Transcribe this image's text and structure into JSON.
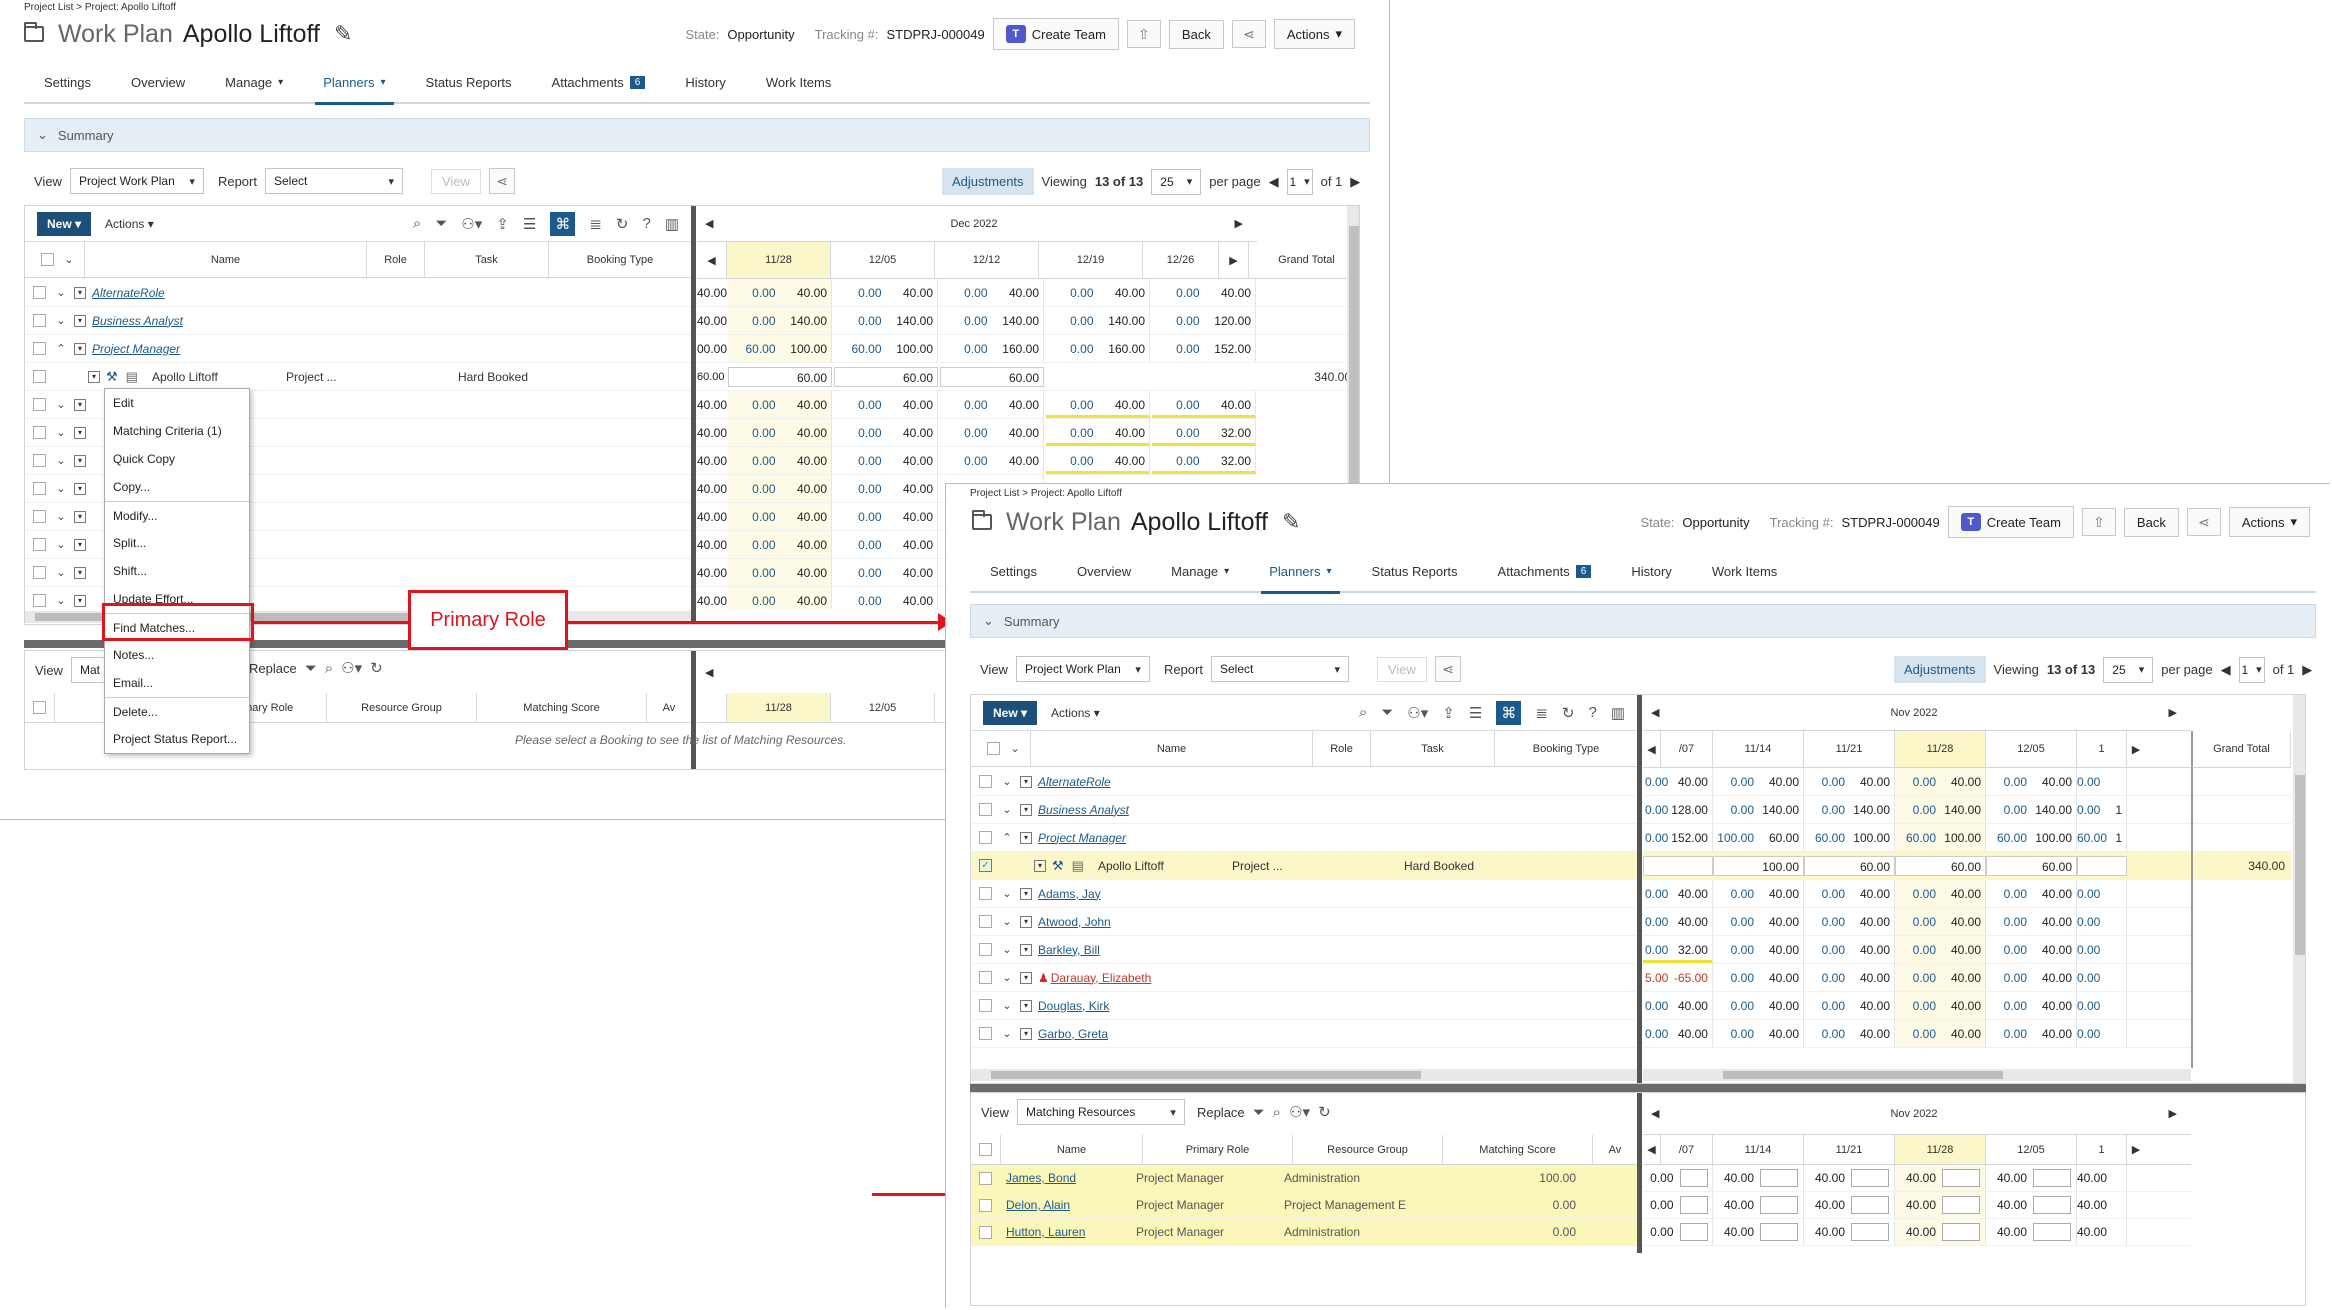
{
  "common": {
    "breadcrumb": "Project List > Project: Apollo Liftoff",
    "work_plan_label": "Work Plan",
    "project_name": "Apollo Liftoff",
    "state_label": "State:",
    "state_value": "Opportunity",
    "tracking_label": "Tracking #:",
    "tracking_value": "STDPRJ-000049",
    "create_team": "Create Team",
    "back": "Back",
    "actions": "Actions",
    "tabs": [
      "Settings",
      "Overview",
      "Manage",
      "Planners",
      "Status Reports",
      "Attachments",
      "History",
      "Work Items"
    ],
    "attachments_count": "6",
    "summary": "Summary",
    "view_label": "View",
    "view_value": "Project Work Plan",
    "report_label": "Report",
    "report_value": "Select",
    "view_btn": "View",
    "adjustments": "Adjustments",
    "viewing": "Viewing",
    "viewing_n": "13 of 13",
    "per_page_value": "25",
    "per_page": "per page",
    "page_value": "1",
    "of_pages": "of 1",
    "new": "New",
    "grid_actions": "Actions",
    "col_name": "Name",
    "col_role": "Role",
    "col_task": "Task",
    "col_booking_type": "Booking Type",
    "grand_total": "Grand Total",
    "booking_name": "Apollo Liftoff",
    "booking_role": "Project ...",
    "booking_type": "Hard Booked",
    "booking_total": "340.00",
    "bottom_view_value": "Matching Resources",
    "replace": "Replace",
    "col_primary_role": "Primary Role",
    "col_resource_group": "Resource Group",
    "col_matching_score": "Matching Score",
    "col_av": "Av",
    "empty_msg": "Please select a Booking to see the list of Matching Resources."
  },
  "back_panel": {
    "month": "Dec 2022",
    "weeks": [
      "11/28",
      "12/05",
      "12/12",
      "12/19",
      "12/26"
    ],
    "role_rows": [
      {
        "name": "AlternateRole",
        "lead": "40.00",
        "pairs": [
          [
            "0.00",
            "40.00"
          ],
          [
            "0.00",
            "40.00"
          ],
          [
            "0.00",
            "40.00"
          ],
          [
            "0.00",
            "40.00"
          ],
          [
            "0.00",
            "40.00"
          ]
        ]
      },
      {
        "name": "Business Analyst",
        "lead": "40.00",
        "pairs": [
          [
            "0.00",
            "140.00"
          ],
          [
            "0.00",
            "140.00"
          ],
          [
            "0.00",
            "140.00"
          ],
          [
            "0.00",
            "140.00"
          ],
          [
            "0.00",
            "120.00"
          ]
        ]
      },
      {
        "name": "Project Manager",
        "lead": "00.00",
        "pairs": [
          [
            "60.00",
            "100.00"
          ],
          [
            "60.00",
            "100.00"
          ],
          [
            "0.00",
            "160.00"
          ],
          [
            "0.00",
            "160.00"
          ],
          [
            "0.00",
            "152.00"
          ]
        ]
      }
    ],
    "booking_vals": [
      "60.00",
      "60.00",
      "60.00",
      "60.00"
    ],
    "res_rows": [
      {
        "lead": "40.00",
        "pairs": [
          [
            "0.00",
            "40.00"
          ],
          [
            "0.00",
            "40.00"
          ],
          [
            "0.00",
            "40.00"
          ],
          [
            "0.00",
            "40.00"
          ],
          [
            "0.00",
            "40.00"
          ]
        ]
      },
      {
        "lead": "40.00",
        "pairs": [
          [
            "0.00",
            "40.00"
          ],
          [
            "0.00",
            "40.00"
          ],
          [
            "0.00",
            "40.00"
          ],
          [
            "0.00",
            "40.00"
          ],
          [
            "0.00",
            "32.00"
          ]
        ]
      },
      {
        "lead": "40.00",
        "pairs": [
          [
            "0.00",
            "40.00"
          ],
          [
            "0.00",
            "40.00"
          ],
          [
            "0.00",
            "40.00"
          ],
          [
            "0.00",
            "40.00"
          ],
          [
            "0.00",
            "32.00"
          ]
        ]
      },
      {
        "lead": "40.00",
        "pairs": [
          [
            "0.00",
            "40.00"
          ],
          [
            "0.00",
            "40.00"
          ],
          [
            "0.00",
            "40.00"
          ]
        ]
      },
      {
        "lead": "40.00",
        "pairs": [
          [
            "0.00",
            "40.00"
          ],
          [
            "0.00",
            "40.00"
          ],
          [
            "0.00",
            "40.00"
          ]
        ]
      },
      {
        "lead": "40.00",
        "pairs": [
          [
            "0.00",
            "40.00"
          ],
          [
            "0.00",
            "40.00"
          ],
          [
            "0.00",
            "40.00"
          ]
        ]
      },
      {
        "lead": "40.00",
        "pairs": [
          [
            "0.00",
            "40.00"
          ],
          [
            "0.00",
            "40.00"
          ],
          [
            "0.00",
            "40.00"
          ]
        ]
      },
      {
        "lead": "40.00",
        "pairs": [
          [
            "0.00",
            "40.00"
          ],
          [
            "0.00",
            "40.00"
          ],
          [
            "0.00",
            "40.00"
          ]
        ]
      }
    ],
    "context_menu": [
      "Edit",
      "Matching Criteria (1)",
      "Quick Copy",
      "Copy...",
      "Modify...",
      "Split...",
      "Shift...",
      "Update Effort...",
      "Find Matches...",
      "Notes...",
      "Email...",
      "Delete...",
      "Project Status Report..."
    ],
    "bottom_view_value": "Mat",
    "bottom_weeks": [
      "11/28",
      "12/05"
    ]
  },
  "callout": "Primary Role",
  "front_panel": {
    "month": "Nov 2022",
    "weeks": [
      "/07",
      "11/14",
      "11/21",
      "11/28",
      "12/05",
      "1"
    ],
    "role_rows": [
      {
        "name": "AlternateRole",
        "pairs": [
          [
            "0.00",
            "40.00"
          ],
          [
            "0.00",
            "40.00"
          ],
          [
            "0.00",
            "40.00"
          ],
          [
            "0.00",
            "40.00"
          ],
          [
            "0.00",
            "40.00"
          ],
          [
            "0.00",
            ""
          ]
        ]
      },
      {
        "name": "Business Analyst",
        "pairs": [
          [
            "0.00",
            "128.00"
          ],
          [
            "0.00",
            "140.00"
          ],
          [
            "0.00",
            "140.00"
          ],
          [
            "0.00",
            "140.00"
          ],
          [
            "0.00",
            "140.00"
          ],
          [
            "0.00",
            "1"
          ]
        ]
      },
      {
        "name": "Project Manager",
        "pairs": [
          [
            "0.00",
            "152.00"
          ],
          [
            "100.00",
            "60.00"
          ],
          [
            "60.00",
            "100.00"
          ],
          [
            "60.00",
            "100.00"
          ],
          [
            "60.00",
            "100.00"
          ],
          [
            "60.00",
            "1"
          ]
        ]
      }
    ],
    "booking_vals": [
      "",
      "100.00",
      "60.00",
      "60.00",
      "60.00",
      ""
    ],
    "resources": [
      {
        "name": "Adams, Jay",
        "red": false,
        "pairs": [
          [
            "0.00",
            "40.00"
          ],
          [
            "0.00",
            "40.00"
          ],
          [
            "0.00",
            "40.00"
          ],
          [
            "0.00",
            "40.00"
          ],
          [
            "0.00",
            "40.00"
          ],
          [
            "0.00",
            ""
          ]
        ]
      },
      {
        "name": "Atwood, John",
        "red": false,
        "pairs": [
          [
            "0.00",
            "40.00"
          ],
          [
            "0.00",
            "40.00"
          ],
          [
            "0.00",
            "40.00"
          ],
          [
            "0.00",
            "40.00"
          ],
          [
            "0.00",
            "40.00"
          ],
          [
            "0.00",
            ""
          ]
        ]
      },
      {
        "name": "Barkley, Bill",
        "red": false,
        "pairs": [
          [
            "0.00",
            "32.00"
          ],
          [
            "0.00",
            "40.00"
          ],
          [
            "0.00",
            "40.00"
          ],
          [
            "0.00",
            "40.00"
          ],
          [
            "0.00",
            "40.00"
          ],
          [
            "0.00",
            ""
          ]
        ]
      },
      {
        "name": "Darauay, Elizabeth",
        "red": true,
        "pairs": [
          [
            "5.00",
            "-65.00"
          ],
          [
            "0.00",
            "40.00"
          ],
          [
            "0.00",
            "40.00"
          ],
          [
            "0.00",
            "40.00"
          ],
          [
            "0.00",
            "40.00"
          ],
          [
            "0.00",
            ""
          ]
        ]
      },
      {
        "name": "Douglas, Kirk",
        "red": false,
        "pairs": [
          [
            "0.00",
            "40.00"
          ],
          [
            "0.00",
            "40.00"
          ],
          [
            "0.00",
            "40.00"
          ],
          [
            "0.00",
            "40.00"
          ],
          [
            "0.00",
            "40.00"
          ],
          [
            "0.00",
            ""
          ]
        ]
      },
      {
        "name": "Garbo, Greta",
        "red": false,
        "pairs": [
          [
            "0.00",
            "40.00"
          ],
          [
            "0.00",
            "40.00"
          ],
          [
            "0.00",
            "40.00"
          ],
          [
            "0.00",
            "40.00"
          ],
          [
            "0.00",
            "40.00"
          ],
          [
            "0.00",
            ""
          ]
        ]
      }
    ],
    "matches": [
      {
        "name": "James, Bond",
        "role": "Project Manager",
        "group": "Administration",
        "score": "100.00",
        "vals": [
          "0.00",
          "40.00",
          "40.00",
          "40.00",
          "40.00",
          "40.00"
        ]
      },
      {
        "name": "Delon, Alain",
        "role": "Project Manager",
        "group": "Project Management E",
        "score": "0.00",
        "vals": [
          "0.00",
          "40.00",
          "40.00",
          "40.00",
          "40.00",
          "40.00"
        ]
      },
      {
        "name": "Hutton, Lauren",
        "role": "Project Manager",
        "group": "Administration",
        "score": "0.00",
        "vals": [
          "0.00",
          "40.00",
          "40.00",
          "40.00",
          "40.00",
          "40.00"
        ]
      }
    ]
  }
}
